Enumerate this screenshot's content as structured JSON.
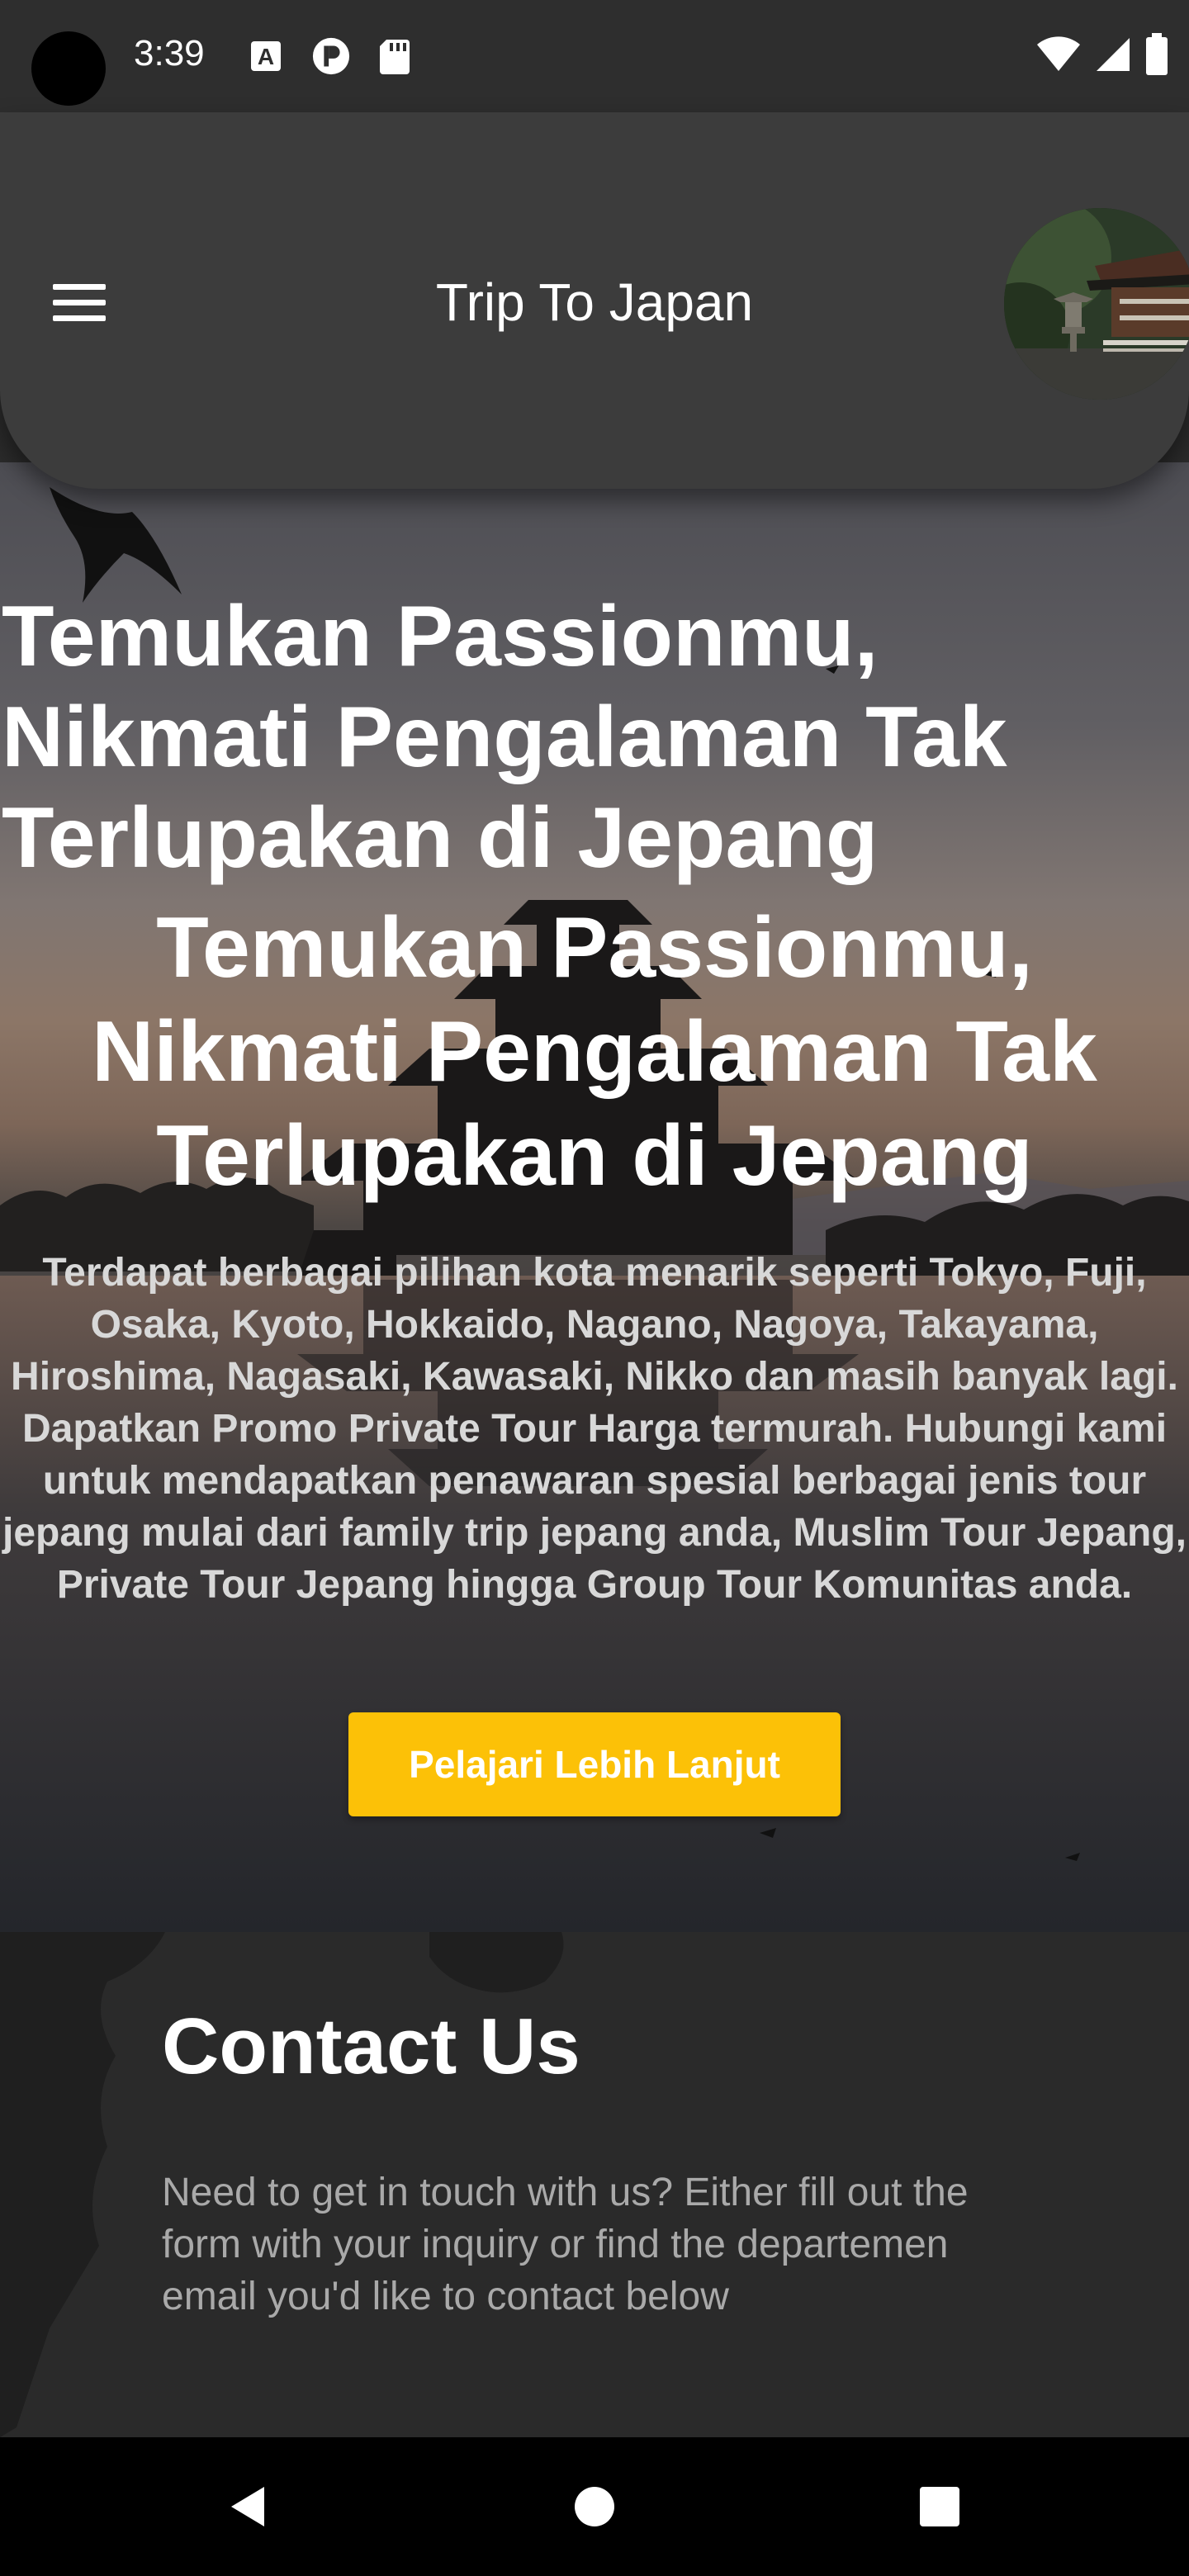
{
  "status_bar": {
    "time": "3:39",
    "left_icons": [
      "a-badge-icon",
      "p-badge-icon",
      "sd-card-icon"
    ],
    "right_icons": [
      "wifi-icon",
      "signal-icon",
      "battery-icon"
    ]
  },
  "app_bar": {
    "title": "Trip To Japan",
    "menu_icon": "hamburger-menu-icon",
    "avatar": "japanese-garden-avatar"
  },
  "hero": {
    "heading": "Temukan Passionmu, Nikmati Pengalaman Tak Terlupakan di Jepang",
    "heading_repeat": "Temukan Passionmu, Nikmati Pengalaman Tak Terlupakan di Jepang",
    "description": "Terdapat berbagai pilihan kota menarik seperti Tokyo, Fuji, Osaka, Kyoto, Hokkaido, Nagano, Nagoya, Takayama, Hiroshima, Nagasaki, Kawasaki, Nikko dan masih banyak lagi. Dapatkan Promo Private Tour Harga termurah. Hubungi kami untuk mendapatkan penawaran spesial berbagai jenis tour jepang mulai dari family trip jepang anda, Muslim Tour Jepang, Private Tour Jepang hingga Group Tour Komunitas anda.",
    "cta_label": "Pelajari Lebih Lanjut",
    "cta_color": "#fcc107"
  },
  "contact": {
    "title": "Contact Us",
    "text": "Need to get in touch with us? Either fill out the form with your inquiry or find the departemen email you'd like to contact below"
  },
  "nav_bar": {
    "icons": [
      "back-triangle-icon",
      "home-circle-icon",
      "recents-square-icon"
    ]
  }
}
